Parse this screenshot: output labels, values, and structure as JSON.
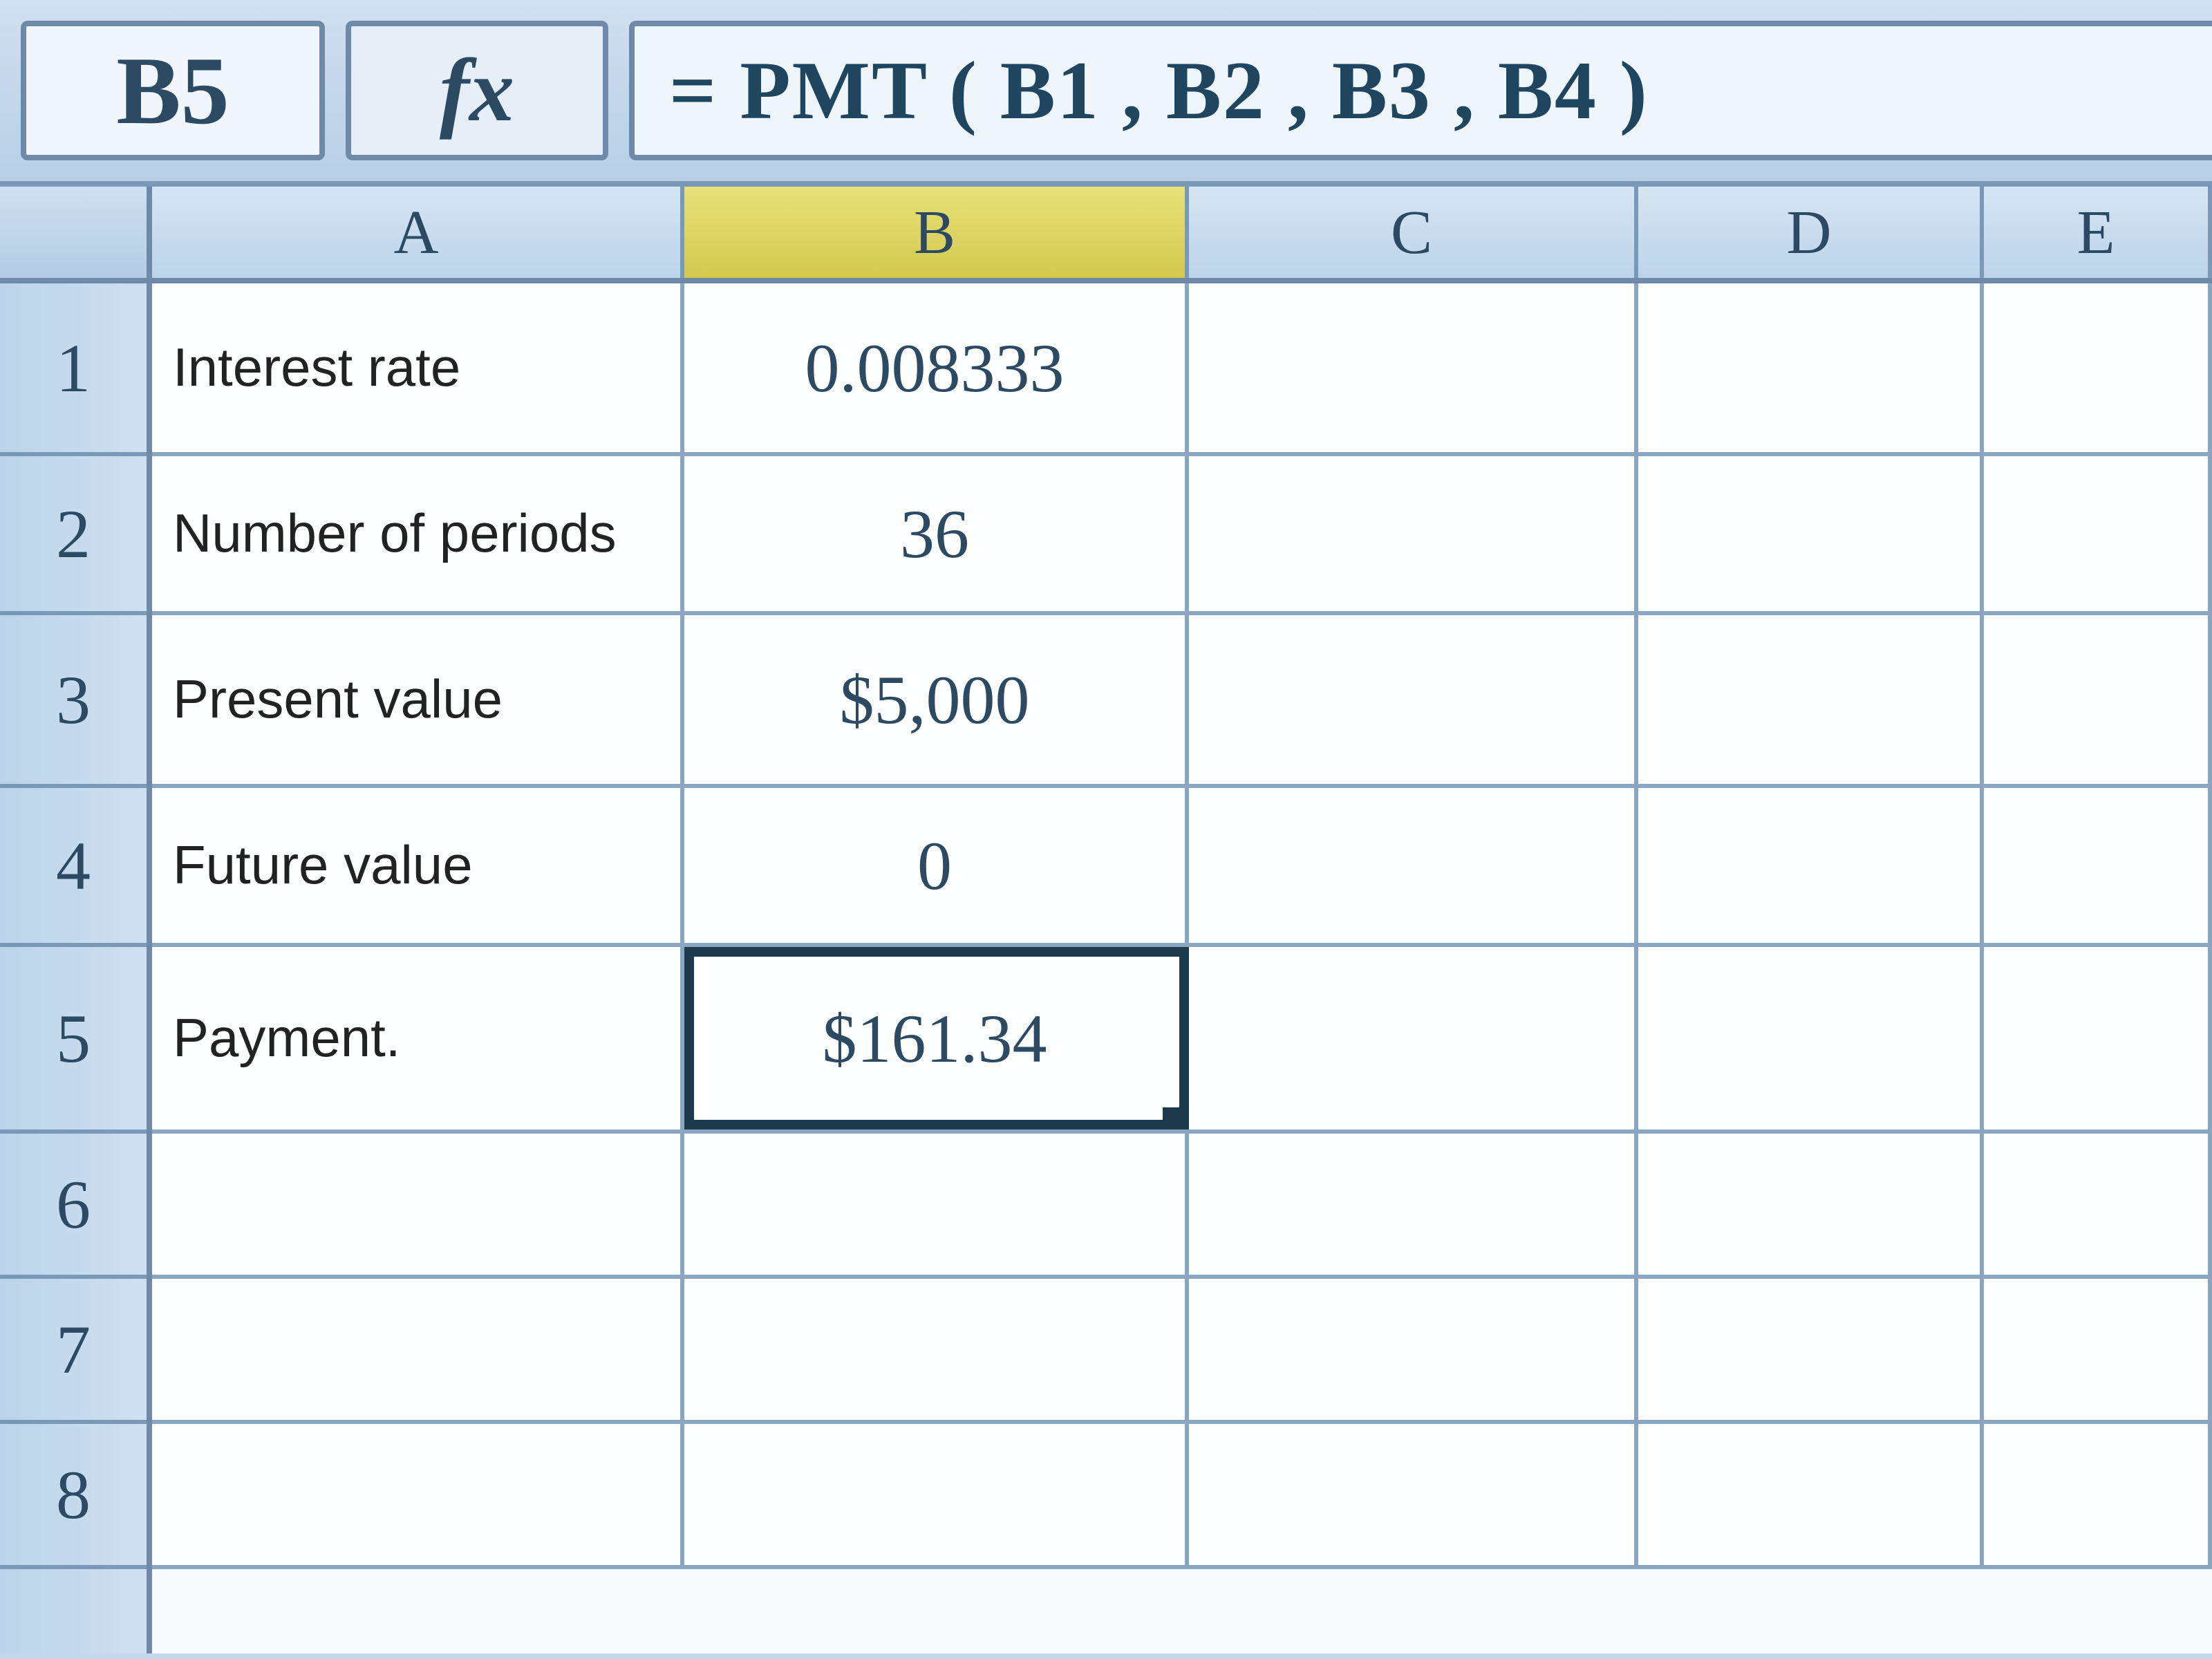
{
  "formula_bar": {
    "cell_ref": "B5",
    "fx_label": "fx",
    "formula": "= PMT ( B1 , B2 , B3 , B4 )"
  },
  "columns": [
    "A",
    "B",
    "C",
    "D",
    "E"
  ],
  "active_column": "B",
  "selection": "B5",
  "rows": [
    {
      "num": "1",
      "A": "Interest rate",
      "B": "0.008333"
    },
    {
      "num": "2",
      "A": "Number of periods",
      "B": "36"
    },
    {
      "num": "3",
      "A": "Present value",
      "B": "$5,000"
    },
    {
      "num": "4",
      "A": "Future value",
      "B": "0"
    },
    {
      "num": "5",
      "A": "Payment.",
      "B": "$161.34"
    },
    {
      "num": "6",
      "A": "",
      "B": ""
    },
    {
      "num": "7",
      "A": "",
      "B": ""
    },
    {
      "num": "8",
      "A": "",
      "B": ""
    }
  ]
}
